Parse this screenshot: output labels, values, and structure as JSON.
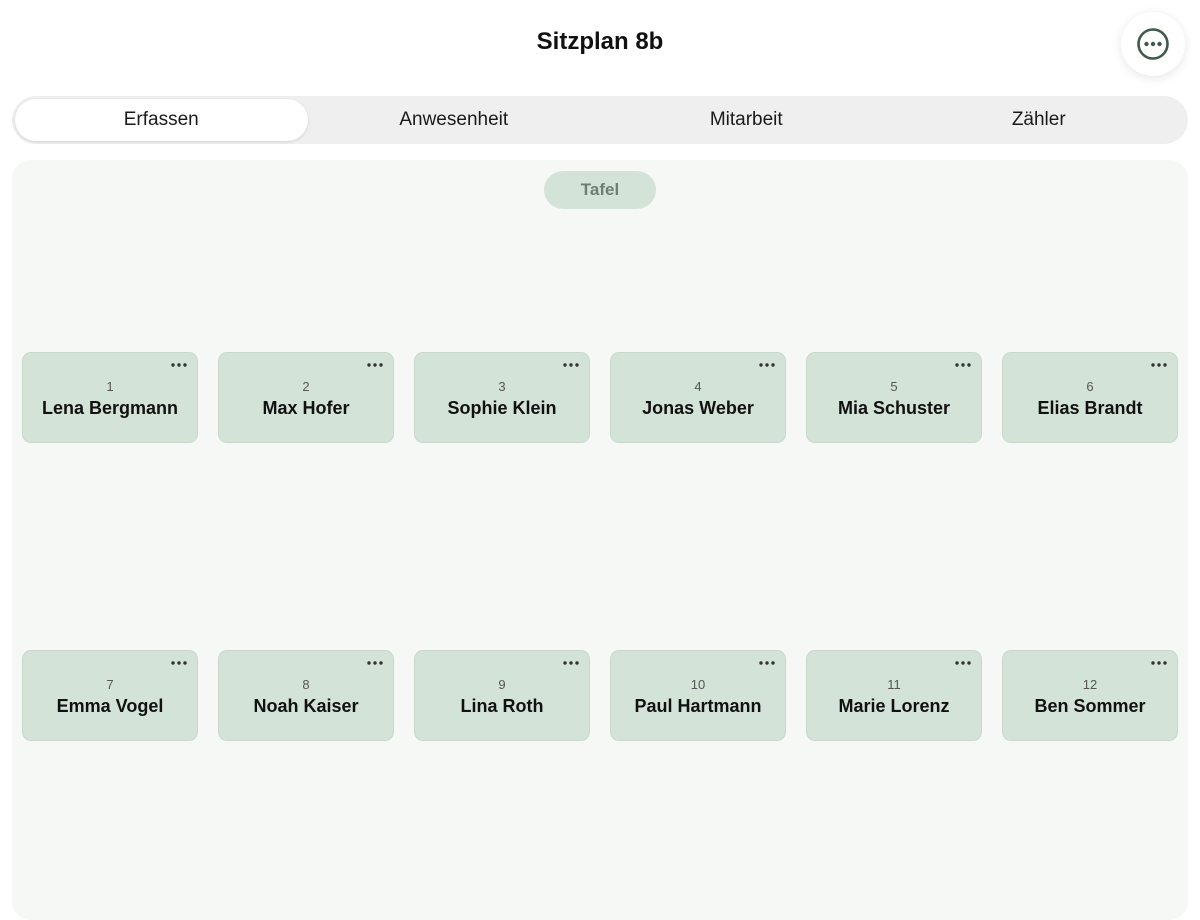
{
  "header": {
    "title": "Sitzplan 8b",
    "more_icon": "ellipsis-circle-icon",
    "accent_color": "#3d5a4a"
  },
  "tabs": [
    {
      "label": "Erfassen",
      "active": true
    },
    {
      "label": "Anwesenheit",
      "active": false
    },
    {
      "label": "Mitarbeit",
      "active": false
    },
    {
      "label": "Zähler",
      "active": false
    }
  ],
  "room": {
    "board_label": "Tafel",
    "seat_color": "#d4e3d7",
    "seats": [
      {
        "number": "1",
        "name": "Lena Bergmann"
      },
      {
        "number": "2",
        "name": "Max Hofer"
      },
      {
        "number": "3",
        "name": "Sophie Klein"
      },
      {
        "number": "4",
        "name": "Jonas Weber"
      },
      {
        "number": "5",
        "name": "Mia Schuster"
      },
      {
        "number": "6",
        "name": "Elias Brandt"
      },
      {
        "number": "7",
        "name": "Emma Vogel"
      },
      {
        "number": "8",
        "name": "Noah Kaiser"
      },
      {
        "number": "9",
        "name": "Lina Roth"
      },
      {
        "number": "10",
        "name": "Paul Hartmann"
      },
      {
        "number": "11",
        "name": "Marie Lorenz"
      },
      {
        "number": "12",
        "name": "Ben Sommer"
      }
    ]
  }
}
